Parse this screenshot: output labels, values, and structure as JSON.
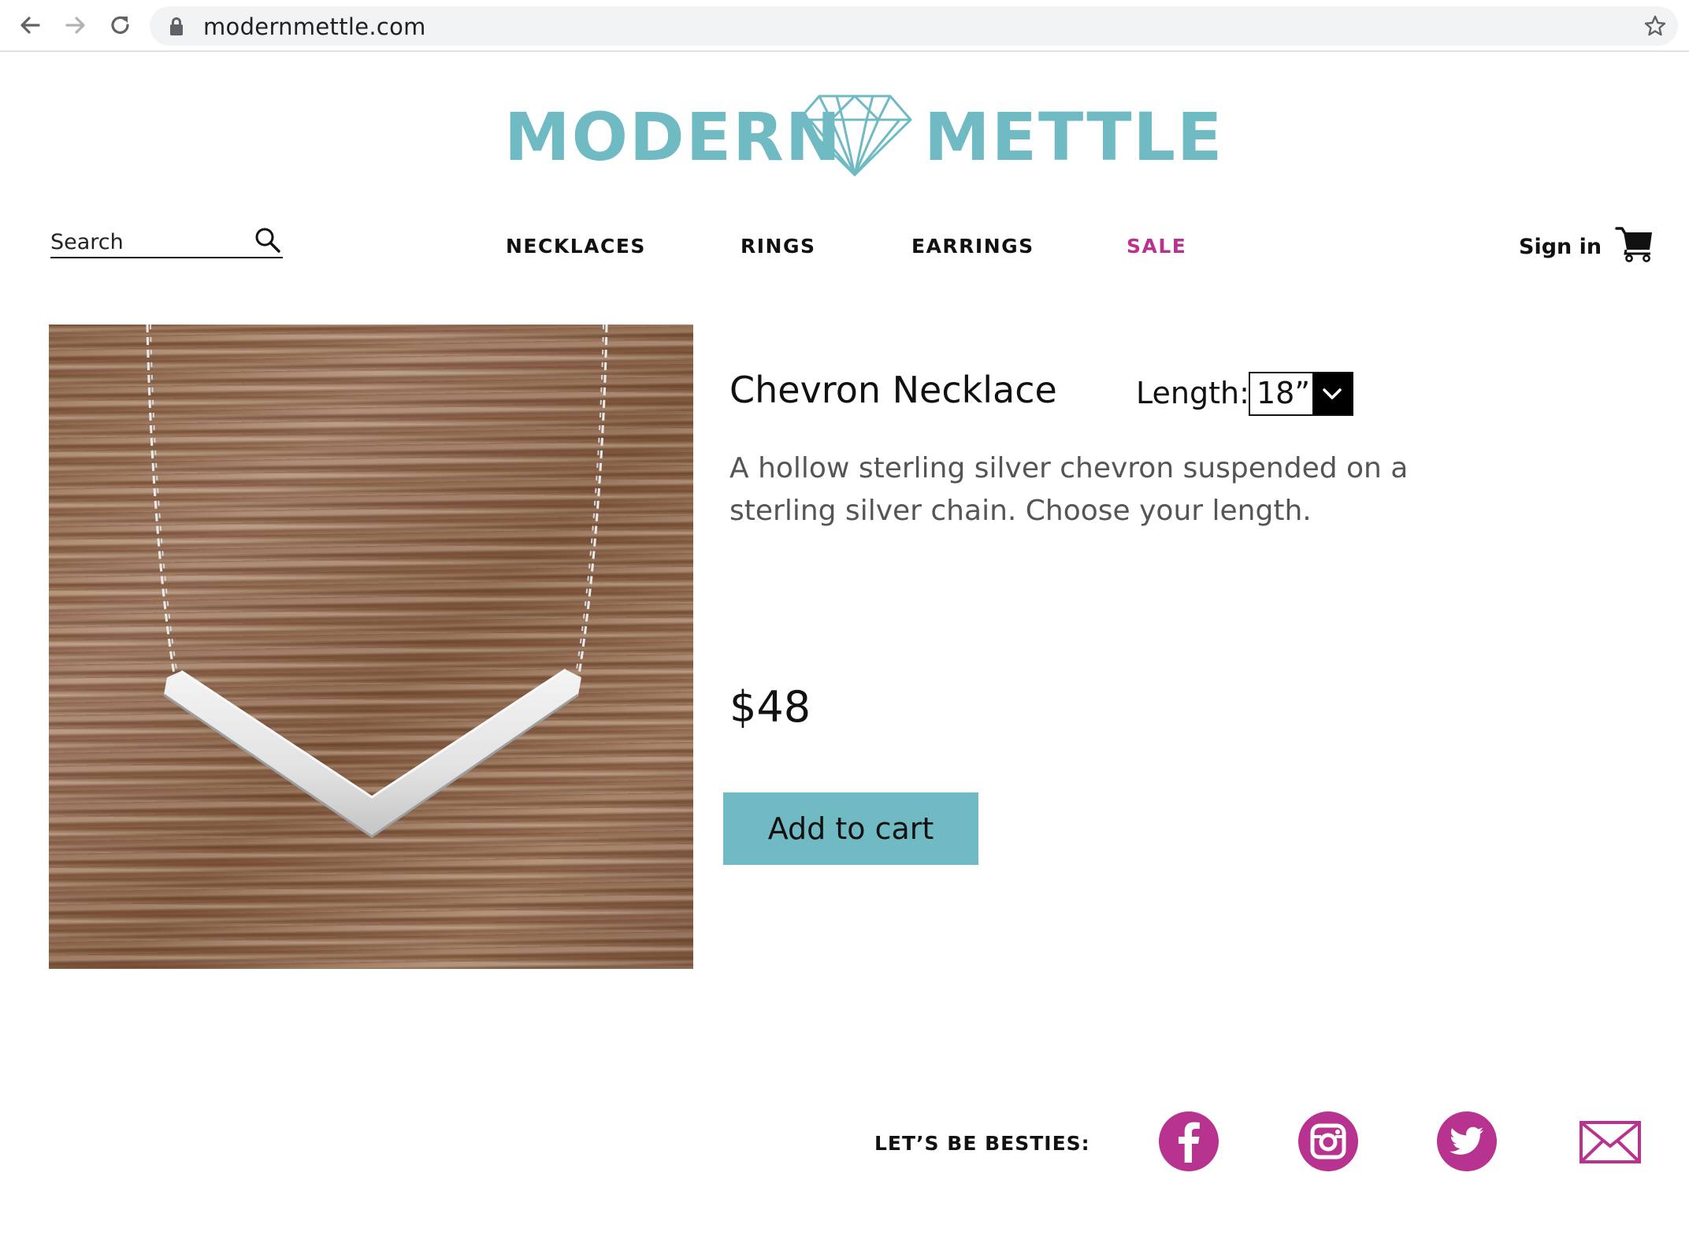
{
  "browser": {
    "url": "modernmettle.com"
  },
  "logo": {
    "word_left": "MODERN",
    "word_right": "METTLE",
    "color": "#6fbac3"
  },
  "search": {
    "placeholder": "Search"
  },
  "nav": {
    "items": [
      {
        "label": "NECKLACES"
      },
      {
        "label": "RINGS"
      },
      {
        "label": "EARRINGS"
      },
      {
        "label": "SALE",
        "color": "#b8338f"
      }
    ],
    "sign_in": "Sign in"
  },
  "product": {
    "title": "Chevron Necklace",
    "length_label": "Length:",
    "length_value": "18”",
    "description": "A hollow sterling silver chevron suspended on a sterling silver chain. Choose your length.",
    "price": "$48",
    "add_to_cart": "Add to cart",
    "button_color": "#6fbac3"
  },
  "footer": {
    "social_label": "LET’S BE BESTIES:",
    "social_color": "#b8338f",
    "icons": [
      "facebook-icon",
      "instagram-icon",
      "twitter-icon",
      "email-icon"
    ]
  }
}
